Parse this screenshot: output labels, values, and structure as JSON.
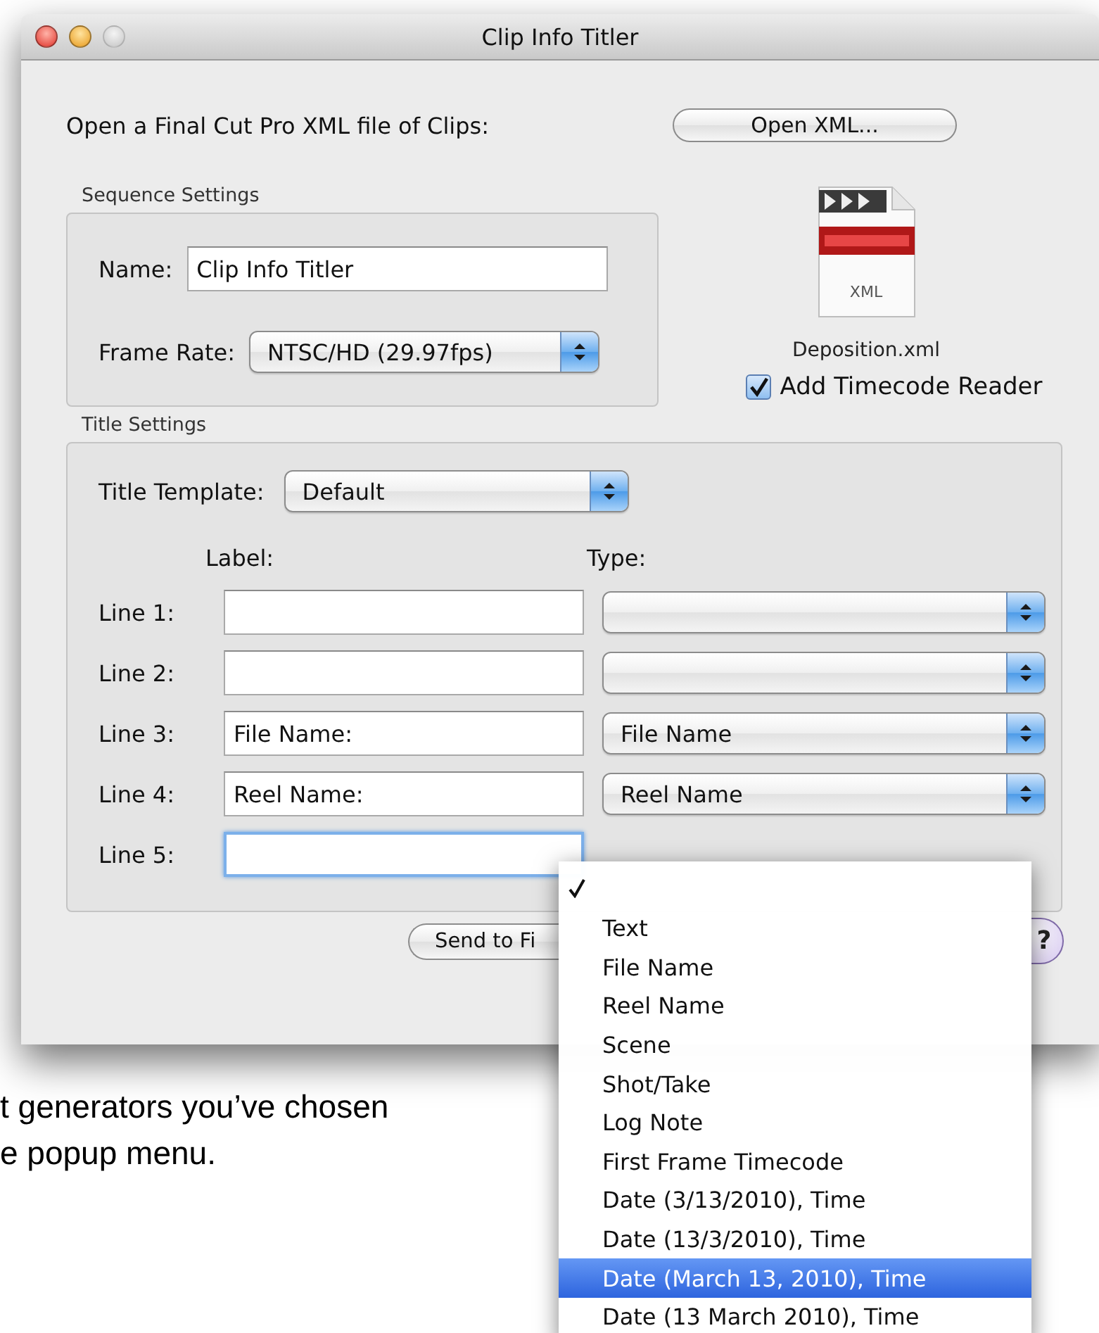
{
  "window": {
    "title": "Clip Info Titler"
  },
  "open_row": {
    "prompt": "Open a Final Cut Pro XML file of Clips:",
    "button": "Open XML..."
  },
  "sequence_settings": {
    "title": "Sequence Settings",
    "name_label": "Name:",
    "name_value": "Clip Info Titler",
    "frame_rate_label": "Frame Rate:",
    "frame_rate_value": "NTSC/HD (29.97fps)"
  },
  "file": {
    "icon_label": "XML",
    "name": "Deposition.xml"
  },
  "timecode_reader": {
    "label": "Add Timecode Reader",
    "checked": true
  },
  "title_settings": {
    "title": "Title Settings",
    "template_label": "Title Template:",
    "template_value": "Default",
    "label_header": "Label:",
    "type_header": "Type:",
    "lines": [
      {
        "label": "Line 1:",
        "focused": false,
        "type_popup": true
      },
      {
        "label": "Line 2:",
        "focused": false,
        "type_popup": true
      },
      {
        "label": "Line 3:",
        "value": "File Name:",
        "type": "File Name",
        "focused": false,
        "type_popup": true
      },
      {
        "label": "Line 4:",
        "value": "Reel Name:",
        "type": "Reel Name",
        "focused": false,
        "type_popup": true
      },
      {
        "label": "Line 5:",
        "focused": true,
        "type_popup": false
      }
    ]
  },
  "buttons": {
    "send": "Send to Fi",
    "help": "?"
  },
  "menu": {
    "items": [
      {
        "checked": true,
        "selected": false
      },
      {
        "label": "Text",
        "checked": false,
        "selected": false
      },
      {
        "label": "File Name",
        "checked": false,
        "selected": false
      },
      {
        "label": "Reel Name",
        "checked": false,
        "selected": false
      },
      {
        "label": "Scene",
        "checked": false,
        "selected": false
      },
      {
        "label": "Shot/Take",
        "checked": false,
        "selected": false
      },
      {
        "label": "Log Note",
        "checked": false,
        "selected": false
      },
      {
        "label": "First Frame Timecode",
        "checked": false,
        "selected": false
      },
      {
        "label": "Date (3/13/2010), Time",
        "checked": false,
        "selected": false
      },
      {
        "label": "Date (13/3/2010), Time",
        "checked": false,
        "selected": false
      },
      {
        "label": "Date (March 13, 2010), Time",
        "checked": false,
        "selected": true
      },
      {
        "label": "Date (13 March 2010), Time",
        "checked": false,
        "selected": false
      }
    ]
  },
  "caption": [
    "t generators you’ve chosen",
    "e popup menu."
  ]
}
